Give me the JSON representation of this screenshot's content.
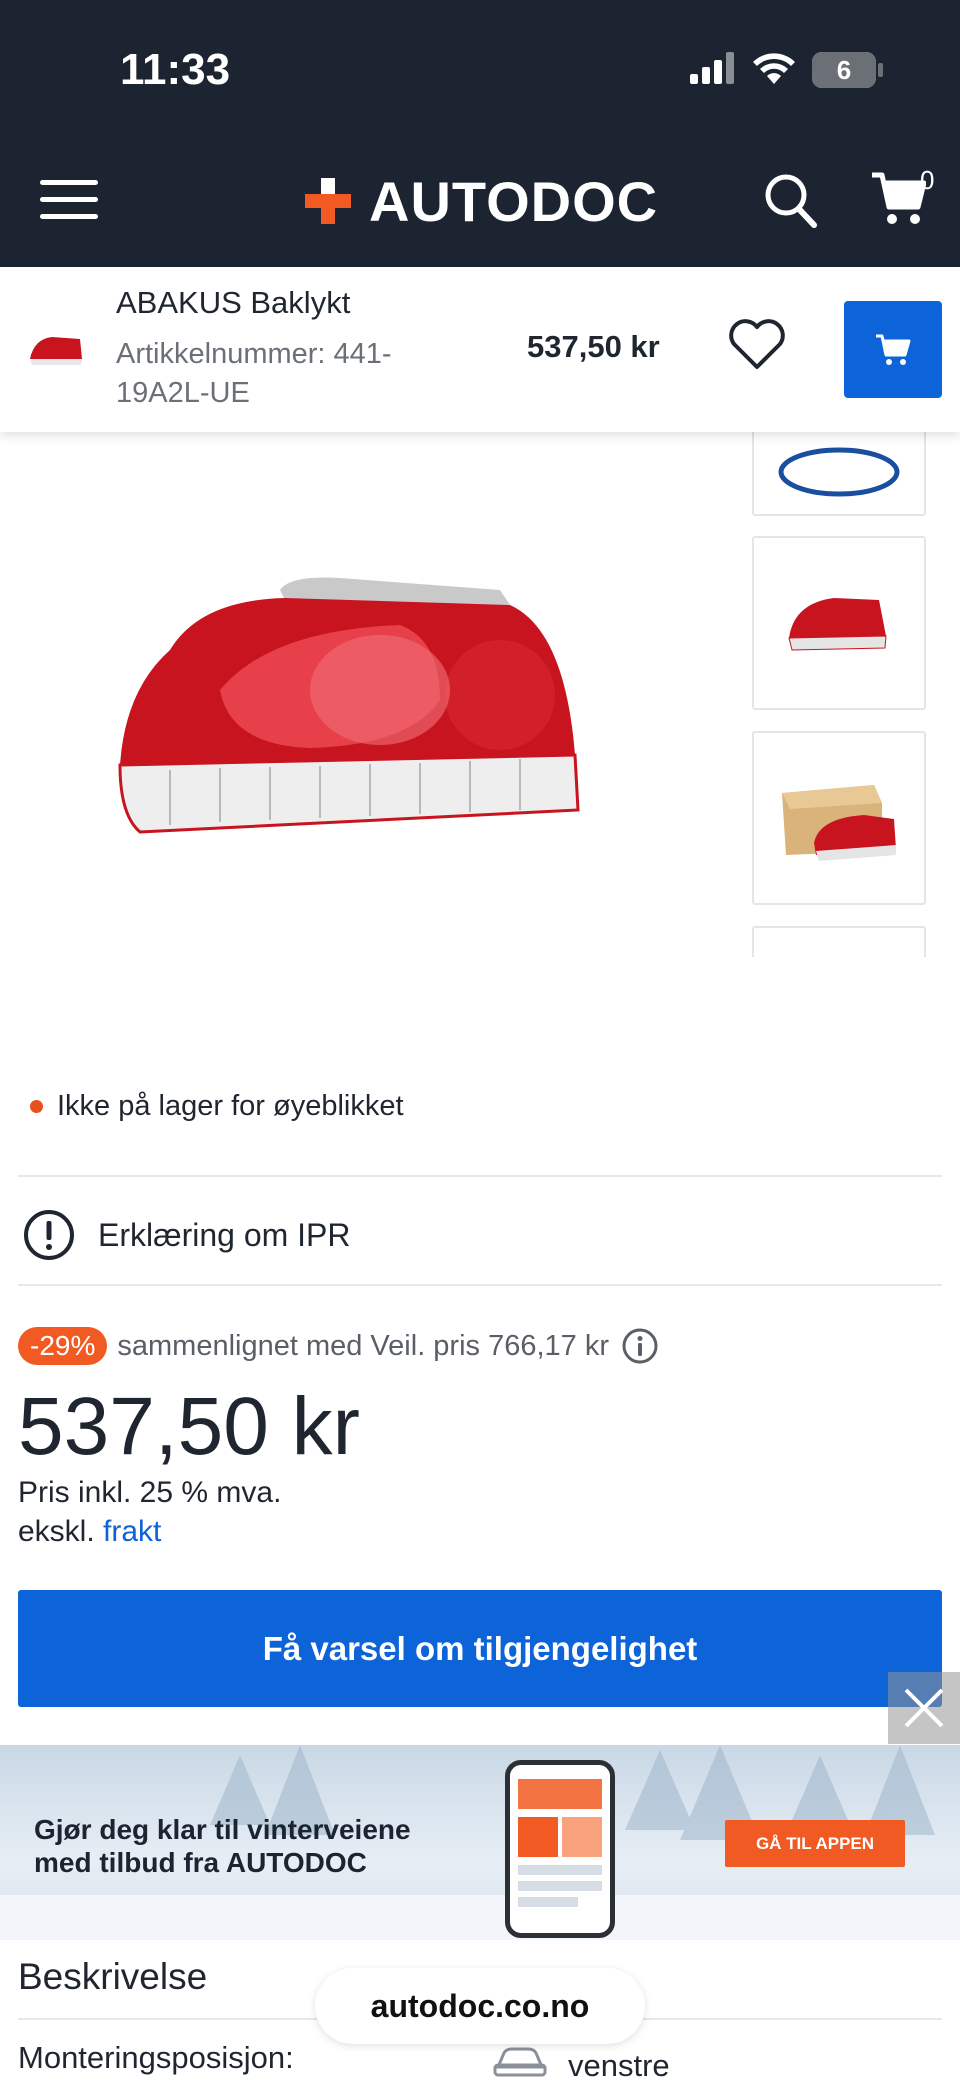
{
  "status_bar": {
    "time": "11:33",
    "battery": "6"
  },
  "header": {
    "logo_text": "AUTODOC",
    "cart_count": "0"
  },
  "sticky_product": {
    "name": "ABAKUS Baklykt",
    "article": "Artikkelnummer: 441-19A2L-UE",
    "price": "537,50 kr"
  },
  "product": {
    "stock_status": "Ikke på lager for øyeblikket",
    "ipr_label": "Erklæring om IPR",
    "discount_badge": "-29%",
    "compare_text": "sammenlignet med Veil. pris 766,17 kr",
    "price": "537,50 kr",
    "vat_line": "Pris inkl. 25 % mva.",
    "shipping_prefix": "ekskl.",
    "shipping_link": "frakt",
    "cta_label": "Få varsel om tilgjengelighet"
  },
  "banner": {
    "text_line1": "Gjør deg klar til vinterveiene",
    "text_line2": "med tilbud fra AUTODOC",
    "button": "GÅ TIL APPEN"
  },
  "description": {
    "heading": "Beskrivelse",
    "rows": [
      {
        "label": "Monteringsposisjon:",
        "value": "venstre"
      }
    ]
  },
  "browser": {
    "url": "autodoc.co.no"
  },
  "colors": {
    "brand_dark": "#1b2430",
    "accent_blue": "#0d63d8",
    "accent_orange": "#f15a22",
    "stock_dot": "#e8501e"
  }
}
